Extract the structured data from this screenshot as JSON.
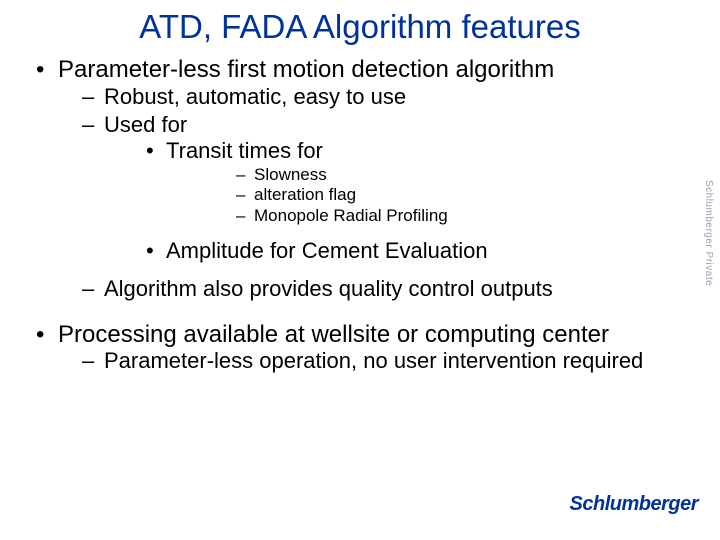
{
  "title": "ATD, FADA Algorithm features",
  "bullets": {
    "b1": "Parameter-less first motion detection algorithm",
    "b1_1": "Robust, automatic, easy to use",
    "b1_2": "Used for",
    "b1_2_a": "Transit times for",
    "b1_2_a_i": "Slowness",
    "b1_2_a_ii": "alteration flag",
    "b1_2_a_iii": "Monopole Radial Profiling",
    "b1_2_b": "Amplitude for Cement Evaluation",
    "b1_3": "Algorithm also provides quality control outputs",
    "b2": "Processing available at wellsite or computing center",
    "b2_1": "Parameter-less operation, no user intervention required"
  },
  "watermark": "Schlumberger Private",
  "brand": "Schlumberger"
}
